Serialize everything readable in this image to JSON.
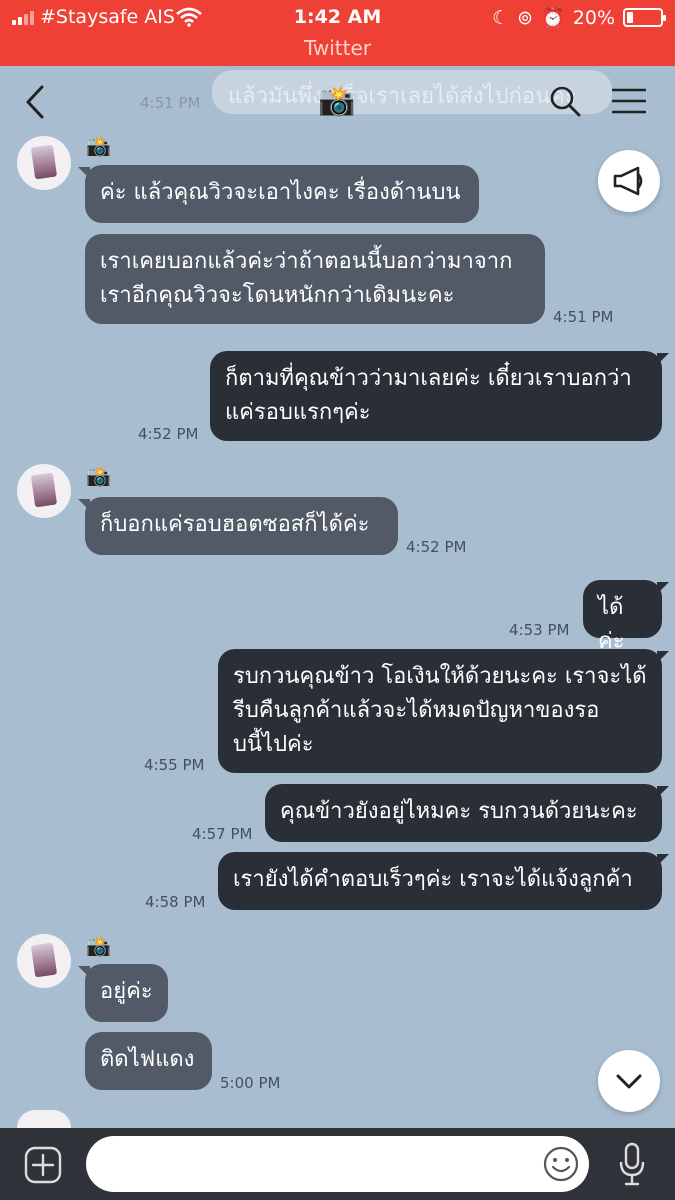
{
  "status_bar": {
    "carrier": "#Staysafe AIS",
    "time": "1:42 AM",
    "battery": "20%",
    "battery_level": 0.2,
    "back_app": "Twitter"
  },
  "header": {
    "title_icon": "📸",
    "ghost_text": "แล้วมันพึ่งเสร็จเราเลยได้ส่งไปก่อนค่ะ",
    "ghost_time": "4:51 PM"
  },
  "chat": {
    "sender_icon": "📸",
    "messages": [
      {
        "text": "ค่ะ แล้วคุณวิวจะเอาไงคะ เรื่องด้านบน",
        "time": ""
      },
      {
        "text": "เราเคยบอกแล้วค่ะว่าถ้าตอนนี้บอกว่ามาจาก\nเราอีกคุณวิวจะโดนหนักกว่าเดิมนะคะ",
        "time": "4:51 PM"
      },
      {
        "text": "ก็ตามที่คุณข้าวว่ามาเลยค่ะ เดี๋ยวเราบอกว่า\nแค่รอบแรกๆค่ะ",
        "time": "4:52 PM"
      },
      {
        "text": "ก็บอกแค่รอบฮอตซอสก็ได้ค่ะ",
        "time": "4:52 PM"
      },
      {
        "text": "ได้ค่ะ",
        "time": "4:53 PM"
      },
      {
        "text": "รบกวนคุณข้าว โอเงินให้ด้วยนะคะ เราจะได้\nรีบคืนลูกค้าแล้วจะได้หมดปัญหาของรอ\nบนี้ไปค่ะ",
        "time": "4:55 PM"
      },
      {
        "text": "คุณข้าวยังอยู่ไหมคะ รบกวนด้วยนะคะ",
        "time": "4:57 PM"
      },
      {
        "text": "เรายังได้คำตอบเร็วๆค่ะ เราจะได้แจ้งลูกค้า",
        "time": "4:58 PM"
      },
      {
        "text": "อยู่ค่ะ",
        "time": ""
      },
      {
        "text": "ติดไฟแดง",
        "time": "5:00 PM"
      }
    ]
  },
  "input": {
    "placeholder": ""
  },
  "colors": {
    "status_bar": "#ef4035",
    "chat_background": "#a9bdd0",
    "incoming_bubble": "#515a66",
    "outgoing_bubble": "#2a2e36",
    "input_bar": "#2f3238"
  },
  "icons": {
    "back": "chevron-left-icon",
    "search": "search-icon",
    "menu": "hamburger-menu-icon",
    "announce": "megaphone-icon",
    "scroll_down": "chevron-down-icon",
    "add": "plus-icon",
    "emoji": "smiley-icon",
    "mic": "microphone-icon"
  }
}
